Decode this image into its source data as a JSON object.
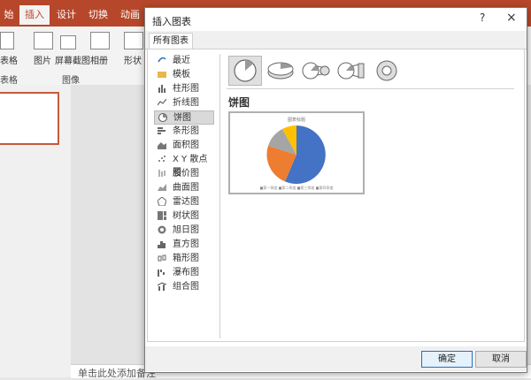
{
  "ribbon_tabs": [
    "始",
    "插入",
    "设计",
    "切换",
    "动画"
  ],
  "ribbon": {
    "buttons": [
      "表格",
      "图片",
      "屏幕截图",
      "相册",
      "形状"
    ],
    "groups": [
      "表格",
      "图像"
    ]
  },
  "notes_placeholder": "单击此处添加备注",
  "dialog": {
    "title": "插入图表",
    "help": "?",
    "close": "×",
    "tab": "所有图表",
    "categories": [
      "最近",
      "模板",
      "柱形图",
      "折线图",
      "饼图",
      "条形图",
      "面积图",
      "X Y 散点图",
      "股价图",
      "曲面图",
      "雷达图",
      "树状图",
      "旭日图",
      "直方图",
      "箱形图",
      "瀑布图",
      "组合图"
    ],
    "selected_category": "饼图",
    "chart_type_title": "饼图",
    "preview_title": "图表标题",
    "preview_legend": "■第一季度  ■第二季度  ■第三季度  ■第四季度",
    "ok": "确定",
    "cancel": "取消"
  },
  "colors": {
    "accent": "#b7472a",
    "pie": [
      "#4472c4",
      "#ed7d31",
      "#a5a5a5",
      "#ffc000"
    ]
  }
}
